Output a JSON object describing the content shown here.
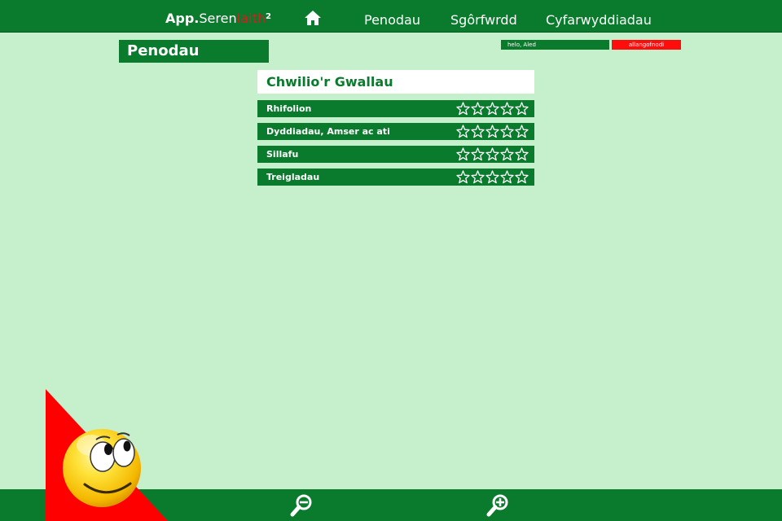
{
  "header": {
    "brand": {
      "part1": "App.",
      "part2": "Seren",
      "part3": "Iaith",
      "sup": "2"
    },
    "nav": [
      {
        "label": "Penodau"
      },
      {
        "label": "Sgôrfwrdd"
      },
      {
        "label": "Cyfarwyddiadau"
      }
    ]
  },
  "user": {
    "greeting": "helo, Aled",
    "logout": "allangofnodi"
  },
  "page": {
    "title": "Penodau"
  },
  "panel": {
    "title": "Chwilio'r Gwallau",
    "chapters": [
      {
        "label": "Rhifolion",
        "stars": 0,
        "max_stars": 5
      },
      {
        "label": "Dyddiadau, Amser ac ati",
        "stars": 0,
        "max_stars": 5
      },
      {
        "label": "Sillafu",
        "stars": 0,
        "max_stars": 5
      },
      {
        "label": "Treigladau",
        "stars": 0,
        "max_stars": 5
      }
    ]
  },
  "footer": {
    "zoom_out_icon": "zoom-out-icon",
    "zoom_in_icon": "zoom-in-icon"
  },
  "colors": {
    "primary": "#0a7a2d",
    "background": "#c6efcc",
    "logout": "#ff0d0d",
    "brand_accent": "#e8141e"
  }
}
